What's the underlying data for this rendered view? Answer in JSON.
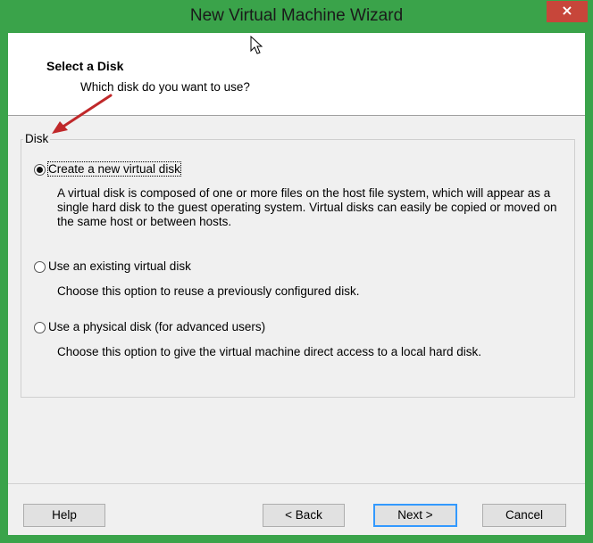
{
  "window": {
    "title": "New Virtual Machine Wizard",
    "close_glyph": "×",
    "accent_color": "#3aa34a"
  },
  "header": {
    "title": "Select a Disk",
    "subtitle": "Which disk do you want to use?"
  },
  "disk_group": {
    "legend": "Disk",
    "options": [
      {
        "label": "Create a new virtual disk",
        "selected": true,
        "description": "A virtual disk is composed of one or more files on the host file system, which will appear as a single hard disk to the guest operating system. Virtual disks can easily be copied or moved on the same host or between hosts."
      },
      {
        "label": "Use an existing virtual disk",
        "selected": false,
        "description": "Choose this option to reuse a previously configured disk."
      },
      {
        "label": "Use a physical disk (for advanced users)",
        "selected": false,
        "description": "Choose this option to give the virtual machine direct access to a local hard disk."
      }
    ]
  },
  "buttons": {
    "help": "Help",
    "back": "< Back",
    "next": "Next >",
    "cancel": "Cancel"
  }
}
